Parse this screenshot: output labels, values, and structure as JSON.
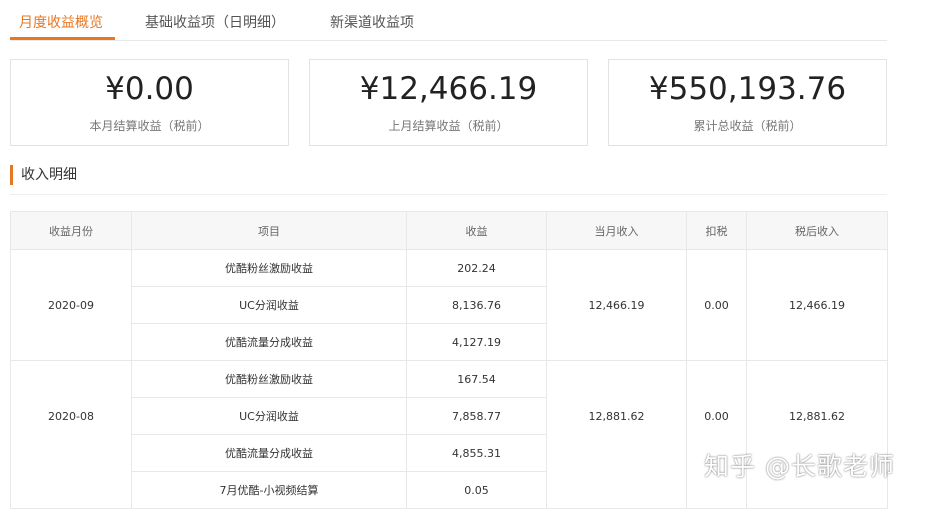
{
  "tabs": [
    {
      "label": "月度收益概览",
      "active": true
    },
    {
      "label": "基础收益项（日明细）",
      "active": false
    },
    {
      "label": "新渠道收益项",
      "active": false
    }
  ],
  "summary_cards": [
    {
      "amount": "¥0.00",
      "label": "本月结算收益（税前）"
    },
    {
      "amount": "¥12,466.19",
      "label": "上月结算收益（税前）"
    },
    {
      "amount": "¥550,193.76",
      "label": "累计总收益（税前）"
    }
  ],
  "section": {
    "title": "收入明细"
  },
  "table": {
    "headers": [
      "收益月份",
      "项目",
      "收益",
      "当月收入",
      "扣税",
      "税后收入"
    ],
    "groups": [
      {
        "month": "2020-09",
        "items": [
          {
            "name": "优酷粉丝激励收益",
            "amount": "202.24"
          },
          {
            "name": "UC分润收益",
            "amount": "8,136.76"
          },
          {
            "name": "优酷流量分成收益",
            "amount": "4,127.19"
          }
        ],
        "monthly_income": "12,466.19",
        "tax": "0.00",
        "after_tax": "12,466.19"
      },
      {
        "month": "2020-08",
        "items": [
          {
            "name": "优酷粉丝激励收益",
            "amount": "167.54"
          },
          {
            "name": "UC分润收益",
            "amount": "7,858.77"
          },
          {
            "name": "优酷流量分成收益",
            "amount": "4,855.31"
          },
          {
            "name": "7月优酷-小视频结算",
            "amount": "0.05"
          }
        ],
        "monthly_income": "12,881.62",
        "tax": "0.00",
        "after_tax": "12,881.62"
      }
    ]
  },
  "watermark": "知乎 @长歌老师",
  "colors": {
    "accent": "#e87722",
    "header_bg": "#f7f7f7",
    "border": "#e8e8e8"
  }
}
